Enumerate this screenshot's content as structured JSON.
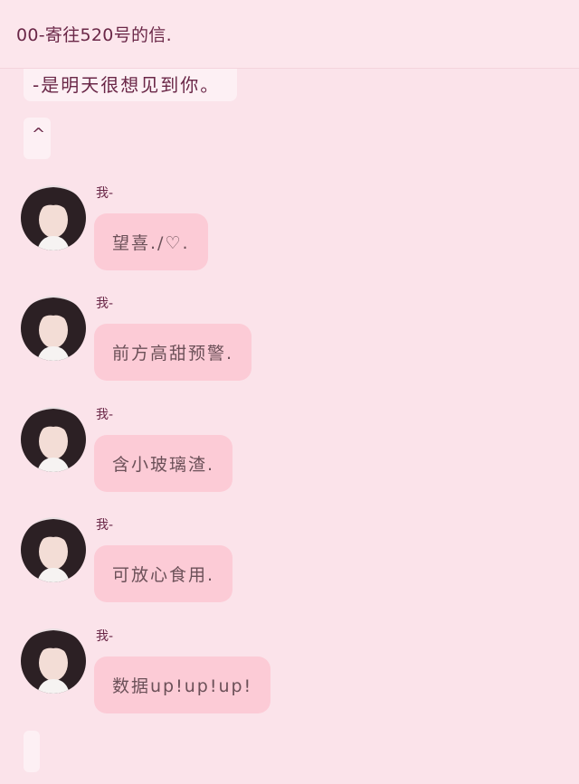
{
  "header": {
    "title": "00-寄往520号的信."
  },
  "top_message": {
    "text": "-是明天很想见到你。"
  },
  "caret_message": {
    "text": "^"
  },
  "messages": [
    {
      "sender": "我-",
      "text": "望喜./♡."
    },
    {
      "sender": "我-",
      "text": "前方高甜预警."
    },
    {
      "sender": "我-",
      "text": "含小玻璃渣."
    },
    {
      "sender": "我-",
      "text": "可放心食用."
    },
    {
      "sender": "我-",
      "text": "数据up!up!up!"
    }
  ]
}
